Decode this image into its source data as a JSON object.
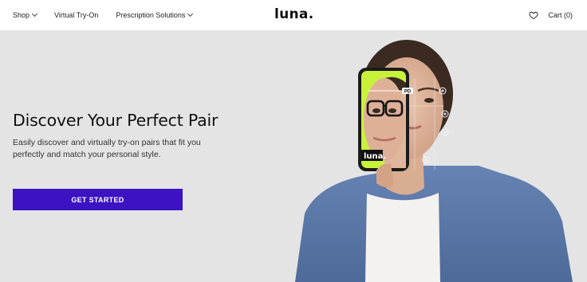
{
  "nav": {
    "shop": "Shop",
    "try_on": "Virtual Try-On",
    "prescription": "Prescription Solutions",
    "logo": "luna.",
    "cart": "Cart (0)"
  },
  "hero": {
    "title": "Discover Your Perfect Pair",
    "subtitle": "Easily discover and virtually try-on pairs that fit you perfectly and match your personal style.",
    "cta": "GET STARTED",
    "phone_logo": "luna.",
    "pd_label": "PD",
    "image_description": "woman in blue knit cardigan holding phone showing virtual glasses try-on"
  },
  "colors": {
    "primary": "#3c12c3",
    "background": "#e4e4e4",
    "accent_green": "#c8f23a",
    "cardigan": "#5b7bab"
  },
  "icons": [
    "chevron-down-icon",
    "heart-icon"
  ]
}
